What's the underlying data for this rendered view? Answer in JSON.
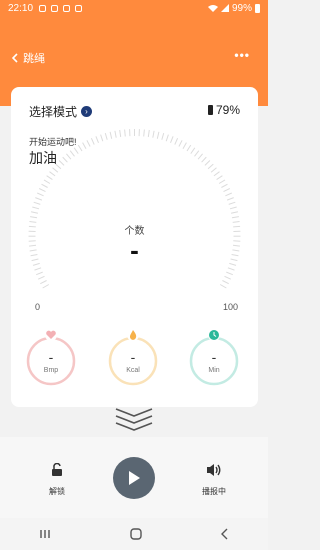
{
  "statusbar": {
    "time": "22:10",
    "battery": "99%"
  },
  "header": {
    "back_label": "跳绳",
    "more": "•••"
  },
  "card": {
    "mode_label": "选择模式",
    "battery": "79%",
    "start_text": "开始运动吧!",
    "cheer_text": "加油",
    "gauge": {
      "label": "个数",
      "value": "-",
      "min": "0",
      "max": "100",
      "progress": 0
    },
    "stats": [
      {
        "value": "-",
        "unit": "Bmp",
        "color": "#f5c6c6",
        "icon": "heart-icon"
      },
      {
        "value": "-",
        "unit": "Kcal",
        "color": "#fae2b8",
        "icon": "flame-icon"
      },
      {
        "value": "-",
        "unit": "Min",
        "color": "#c3ebe3",
        "icon": "clock-icon"
      }
    ]
  },
  "controls": {
    "unlock_label": "解锁",
    "voice_label": "播报中"
  },
  "colors": {
    "accent": "#ff8a3d",
    "play": "#5a6672"
  }
}
